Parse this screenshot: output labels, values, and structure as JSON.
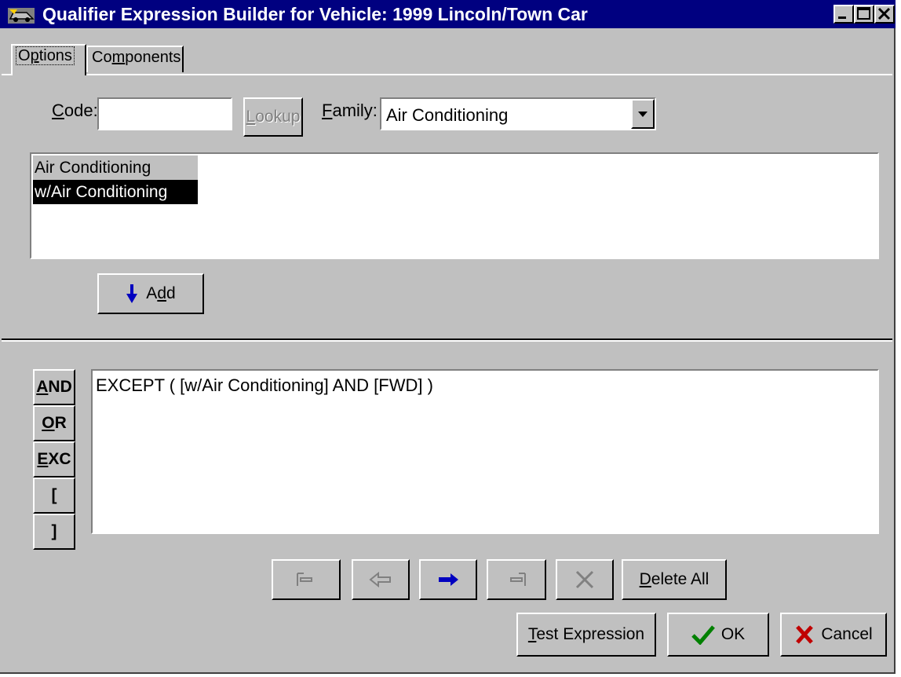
{
  "window": {
    "title": "Qualifier Expression Builder for Vehicle: 1999 Lincoln/Town Car",
    "icon": "car-icon"
  },
  "tabs": [
    {
      "label_pre": "O",
      "label_key": "p",
      "label_post": "tions",
      "active": true
    },
    {
      "label_pre": "Co",
      "label_key": "m",
      "label_post": "ponents",
      "active": false
    }
  ],
  "options": {
    "code_label_key": "C",
    "code_label_rest": "ode:",
    "code_value": "",
    "lookup_label_key": "L",
    "lookup_label_rest": "ookup",
    "family_label_key": "F",
    "family_label_rest": "amily:",
    "family_value": "Air Conditioning",
    "options_list": [
      {
        "label": "Air Conditioning",
        "selected": false
      },
      {
        "label": "w/Air Conditioning",
        "selected": true
      }
    ],
    "add_label_pre": "A",
    "add_label_key": "d",
    "add_label_post": "d"
  },
  "operators": [
    {
      "key": "A",
      "rest": "ND"
    },
    {
      "key": "O",
      "rest": "R"
    },
    {
      "key": "E",
      "rest": "XC"
    },
    {
      "key": "[",
      "rest": ""
    },
    {
      "key": "]",
      "rest": ""
    }
  ],
  "expression": {
    "text": "EXCEPT ( [w/Air Conditioning] AND [FWD] )"
  },
  "toolbar": {
    "move_first": "first-icon",
    "move_left": "arrow-left-icon",
    "move_right": "arrow-right-icon",
    "move_last": "last-icon",
    "delete": "delete-x-icon",
    "delete_all_key": "D",
    "delete_all_rest": "elete All"
  },
  "footer": {
    "test_key": "T",
    "test_rest": "est Expression",
    "ok_label": "OK",
    "cancel_label": "Cancel"
  },
  "colors": {
    "titlebar": "#000080",
    "face": "#c0c0c0",
    "selection": "#000000",
    "arrow_blue": "#0000c0",
    "ok_green": "#008000",
    "cancel_red": "#c00000"
  }
}
